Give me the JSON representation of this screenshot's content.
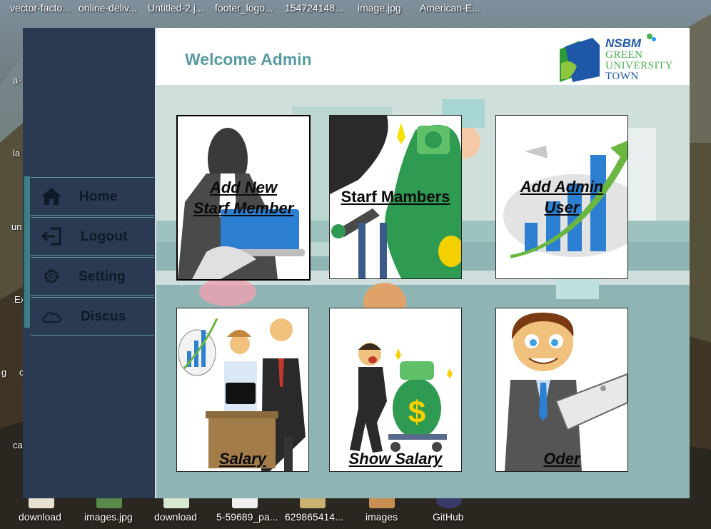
{
  "desktop": {
    "top_icons": [
      "vector-facto...",
      "online-deliv...",
      "Untitled-2.j...",
      "footer_logo...",
      "154724148...",
      "image.jpg",
      "American-E..."
    ],
    "left_icons": [
      "a-",
      "la",
      "un",
      "Ex",
      "g",
      "c",
      "ca"
    ],
    "bottom_icons": [
      "download",
      "images.jpg",
      "download",
      "5-59689_pa...",
      "629865414...",
      "images",
      "GitHub"
    ]
  },
  "header": {
    "welcome": "Welcome Admin",
    "logo": {
      "top": "NSBM",
      "line1": "GREEN",
      "line2": "UNIVERSITY",
      "line3": "TOWN"
    }
  },
  "sidebar": {
    "items": [
      {
        "label": "Home",
        "icon": "home-icon"
      },
      {
        "label": "Logout",
        "icon": "logout-icon"
      },
      {
        "label": "Setting",
        "icon": "gear-icon"
      },
      {
        "label": "Discus",
        "icon": "cloud-icon"
      }
    ]
  },
  "cards": [
    {
      "line1": "Add New",
      "line2": "Starf Member"
    },
    {
      "line1": "Starf Mambers",
      "line2": ""
    },
    {
      "line1": "Add Admin",
      "line2": "User"
    },
    {
      "line1": "Salary",
      "line2": ""
    },
    {
      "line1": "Show  Salary",
      "line2": ""
    },
    {
      "line1": "Oder",
      "line2": ""
    }
  ],
  "colors": {
    "sidebar": "#2a3a52",
    "accent": "#3d7f86",
    "welcome": "#5a9aa2",
    "brand_green": "#4caf50",
    "brand_blue": "#1f57a8"
  }
}
